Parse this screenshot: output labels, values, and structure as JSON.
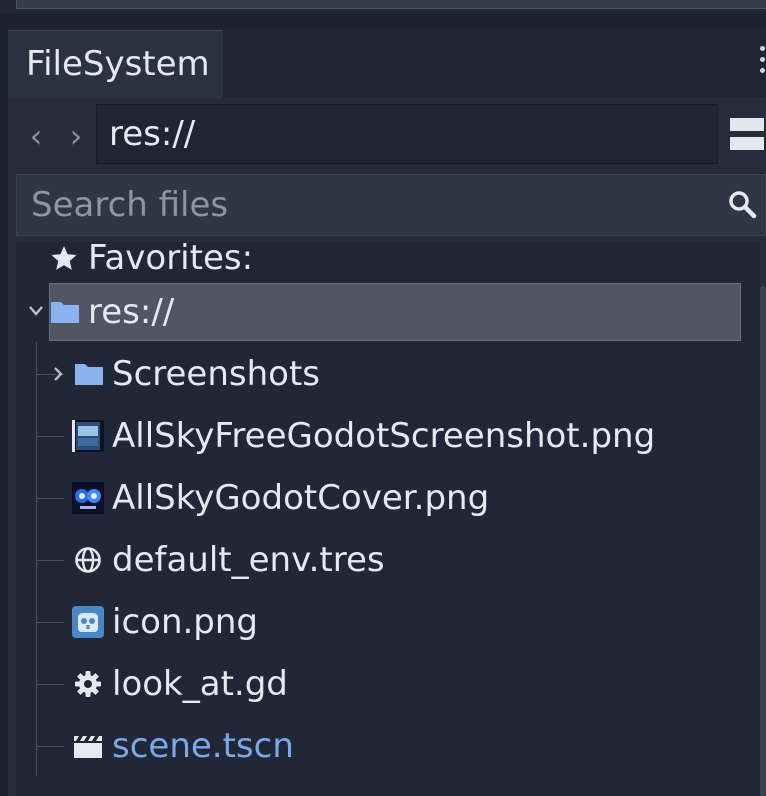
{
  "panel": {
    "tab_label": "FileSystem"
  },
  "nav": {
    "back_glyph": "‹",
    "forward_glyph": "›"
  },
  "path": {
    "value": "res://"
  },
  "search": {
    "placeholder": "Search files",
    "value": ""
  },
  "tree": {
    "favorites_label": "Favorites:",
    "root_label": "res://",
    "items": [
      {
        "label": "Screenshots",
        "icon": "folder-icon",
        "type": "folder"
      },
      {
        "label": "AllSkyFreeGodotScreenshot.png",
        "icon": "image-thumbnail-icon",
        "type": "file"
      },
      {
        "label": "AllSkyGodotCover.png",
        "icon": "image-thumbnail-icon",
        "type": "file"
      },
      {
        "label": "default_env.tres",
        "icon": "globe-icon",
        "type": "file"
      },
      {
        "label": "icon.png",
        "icon": "godot-logo-icon",
        "type": "file"
      },
      {
        "label": "look_at.gd",
        "icon": "gear-icon",
        "type": "file"
      },
      {
        "label": "scene.tscn",
        "icon": "clapperboard-icon",
        "type": "scene"
      }
    ]
  },
  "colors": {
    "accent_folder": "#8bb3ef",
    "scene_link": "#7aa8e8",
    "selection": "#505664",
    "panel_bg": "#262c3b"
  }
}
